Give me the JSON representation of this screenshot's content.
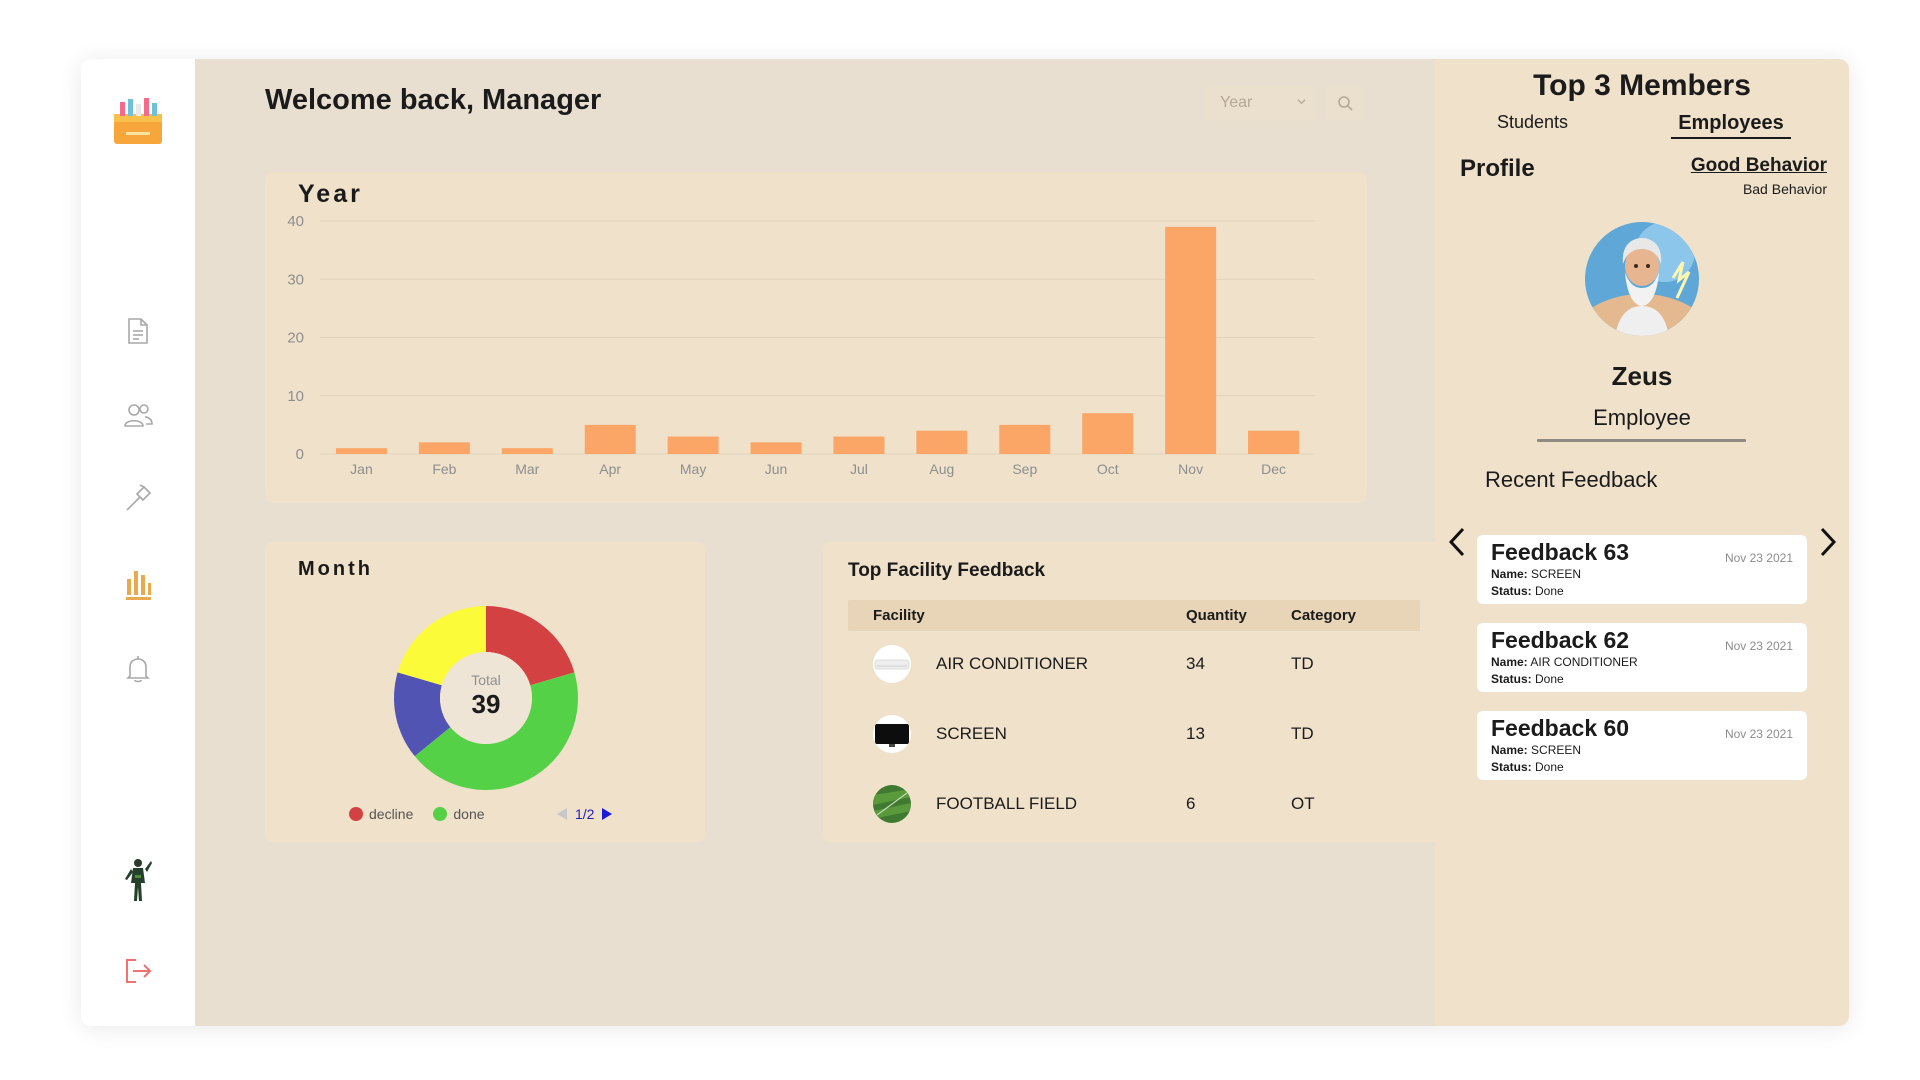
{
  "header": {
    "title": "Welcome back, Manager",
    "period_select": "Year"
  },
  "sidebar": {
    "items": [
      {
        "name": "reports",
        "icon": "document-icon"
      },
      {
        "name": "users",
        "icon": "users-icon"
      },
      {
        "name": "facilities",
        "icon": "hammer-icon"
      },
      {
        "name": "statistics",
        "icon": "bar-chart-icon",
        "active": true
      },
      {
        "name": "notifications",
        "icon": "bell-icon"
      }
    ],
    "logout_icon": "logout-icon"
  },
  "year_card": {
    "title": "Year"
  },
  "month_card": {
    "title": "Month",
    "total_label": "Total",
    "total_value": "39",
    "legend": [
      {
        "label": "decline",
        "color": "#d44142"
      },
      {
        "label": "done",
        "color": "#55d147"
      }
    ],
    "pager": "1/2"
  },
  "facility_card": {
    "title": "Top Facility Feedback",
    "columns": [
      "Facility",
      "Quantity",
      "Category"
    ],
    "rows": [
      {
        "name": "AIR CONDITIONER",
        "quantity": "34",
        "category": "TD"
      },
      {
        "name": "SCREEN",
        "quantity": "13",
        "category": "TD"
      },
      {
        "name": "FOOTBALL FIELD",
        "quantity": "6",
        "category": "OT"
      }
    ]
  },
  "right_panel": {
    "title": "Top 3 Members",
    "tabs": {
      "students": "Students",
      "employees": "Employees"
    },
    "profile_label": "Profile",
    "behavior": {
      "good": "Good Behavior",
      "bad": "Bad Behavior"
    },
    "member": {
      "name": "Zeus",
      "role": "Employee"
    },
    "recent_title": "Recent Feedback",
    "name_label": "Name:",
    "status_label": "Status:",
    "feedback": [
      {
        "title": "Feedback 63",
        "date": "Nov 23 2021",
        "name": "SCREEN",
        "status": "Done"
      },
      {
        "title": "Feedback 62",
        "date": "Nov 23 2021",
        "name": "AIR CONDITIONER",
        "status": "Done"
      },
      {
        "title": "Feedback 60",
        "date": "Nov 23 2021",
        "name": "SCREEN",
        "status": "Done"
      }
    ]
  },
  "chart_data": [
    {
      "type": "bar",
      "categories": [
        "Jan",
        "Feb",
        "Mar",
        "Apr",
        "May",
        "Jun",
        "Jul",
        "Aug",
        "Sep",
        "Oct",
        "Nov",
        "Dec"
      ],
      "values": [
        1,
        2,
        1,
        5,
        3,
        2,
        3,
        4,
        5,
        7,
        39,
        4
      ],
      "ylim": [
        0,
        40
      ],
      "yticks": [
        0,
        10,
        20,
        30,
        40
      ],
      "color": "#fba567",
      "grid": true
    },
    {
      "type": "pie",
      "labels": [
        "decline",
        "done",
        "",
        ""
      ],
      "values": [
        8,
        17,
        6,
        8
      ],
      "colors": [
        "#d44142",
        "#55d147",
        "#5254b3",
        "#fbfb3a"
      ]
    }
  ]
}
